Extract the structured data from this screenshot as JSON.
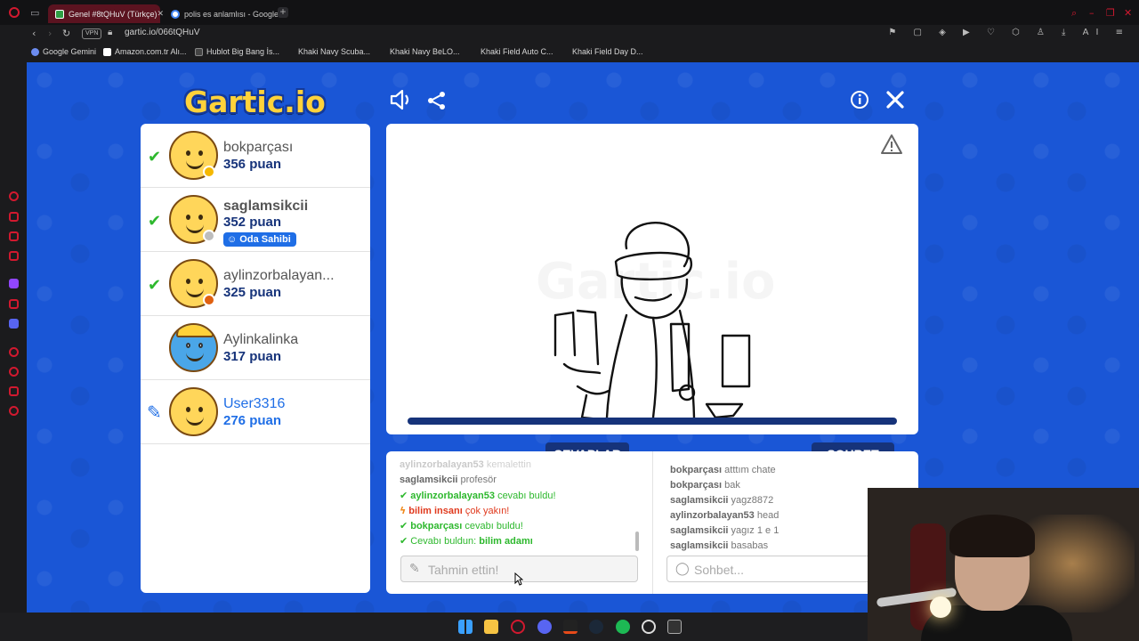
{
  "browser": {
    "tabs": [
      {
        "title": "Genel #8tQHuV (Türkçe)",
        "active": true
      },
      {
        "title": "polis es anlamlısı - Google",
        "active": false
      }
    ],
    "vpn_label": "VPN",
    "url": "gartic.io/066tQHuV",
    "bookmarks": [
      "Google Gemini",
      "Amazon.com.tr Alı...",
      "Hublot Big Bang İs...",
      "Khaki Navy Scuba...",
      "Khaki Navy BeLO...",
      "Khaki Field Auto C...",
      "Khaki Field Day D..."
    ],
    "toolbar_ai_label": "AI"
  },
  "game": {
    "logo": "Gartic.io",
    "players": [
      {
        "name": "bokparçası",
        "score": "356 puan",
        "guessed": true,
        "status_color": "#f5b800"
      },
      {
        "name": "saglamsikcii",
        "score": "352 puan",
        "guessed": true,
        "status_color": "#bdbdbd",
        "badge": "Oda Sahibi"
      },
      {
        "name": "aylinzorbalayan...",
        "score": "325 puan",
        "guessed": true,
        "status_color": "#e06010"
      },
      {
        "name": "Aylinkalinka",
        "score": "317 puan",
        "guessed": false
      },
      {
        "name": "User3316",
        "score": "276 puan",
        "drawing": true
      }
    ],
    "answers_tab": "CEVAPLAR",
    "chat_tab": "SOHBET",
    "answers": [
      {
        "user": "aylinzorbalayan53",
        "text": "kemalettin",
        "style": "faded"
      },
      {
        "user": "saglamsikcii",
        "text": "profesör",
        "style": "normal"
      },
      {
        "user": "aylinzorbalayan53",
        "text": "cevabı buldu!",
        "style": "green"
      },
      {
        "user": "bilim insanı",
        "text": "çok yakın!",
        "style": "red"
      },
      {
        "user": "bokparçası",
        "text": "cevabı buldu!",
        "style": "green"
      },
      {
        "user": "Cevabı buldun:",
        "text": "bilim adamı",
        "style": "found"
      }
    ],
    "answer_placeholder": "Tahmin ettin!",
    "chat": [
      {
        "user": "bokparçası",
        "text": "atttım chate"
      },
      {
        "user": "bokparçası",
        "text": "bak"
      },
      {
        "user": "saglamsikcii",
        "text": "yagz8872"
      },
      {
        "user": "aylinzorbalayan53",
        "text": "head"
      },
      {
        "user": "saglamsikcii",
        "text": "yagız 1 e 1"
      },
      {
        "user": "saglamsikcii",
        "text": "basabas"
      }
    ],
    "chat_placeholder": "Sohbet...",
    "drawing_progress": 1.0,
    "accent_color": "#1a56d6",
    "dark_accent": "#16337a"
  },
  "icons": {
    "sound": "speaker-icon",
    "share": "share-icon",
    "info": "info-icon",
    "close": "close-icon",
    "report": "warning-icon"
  }
}
